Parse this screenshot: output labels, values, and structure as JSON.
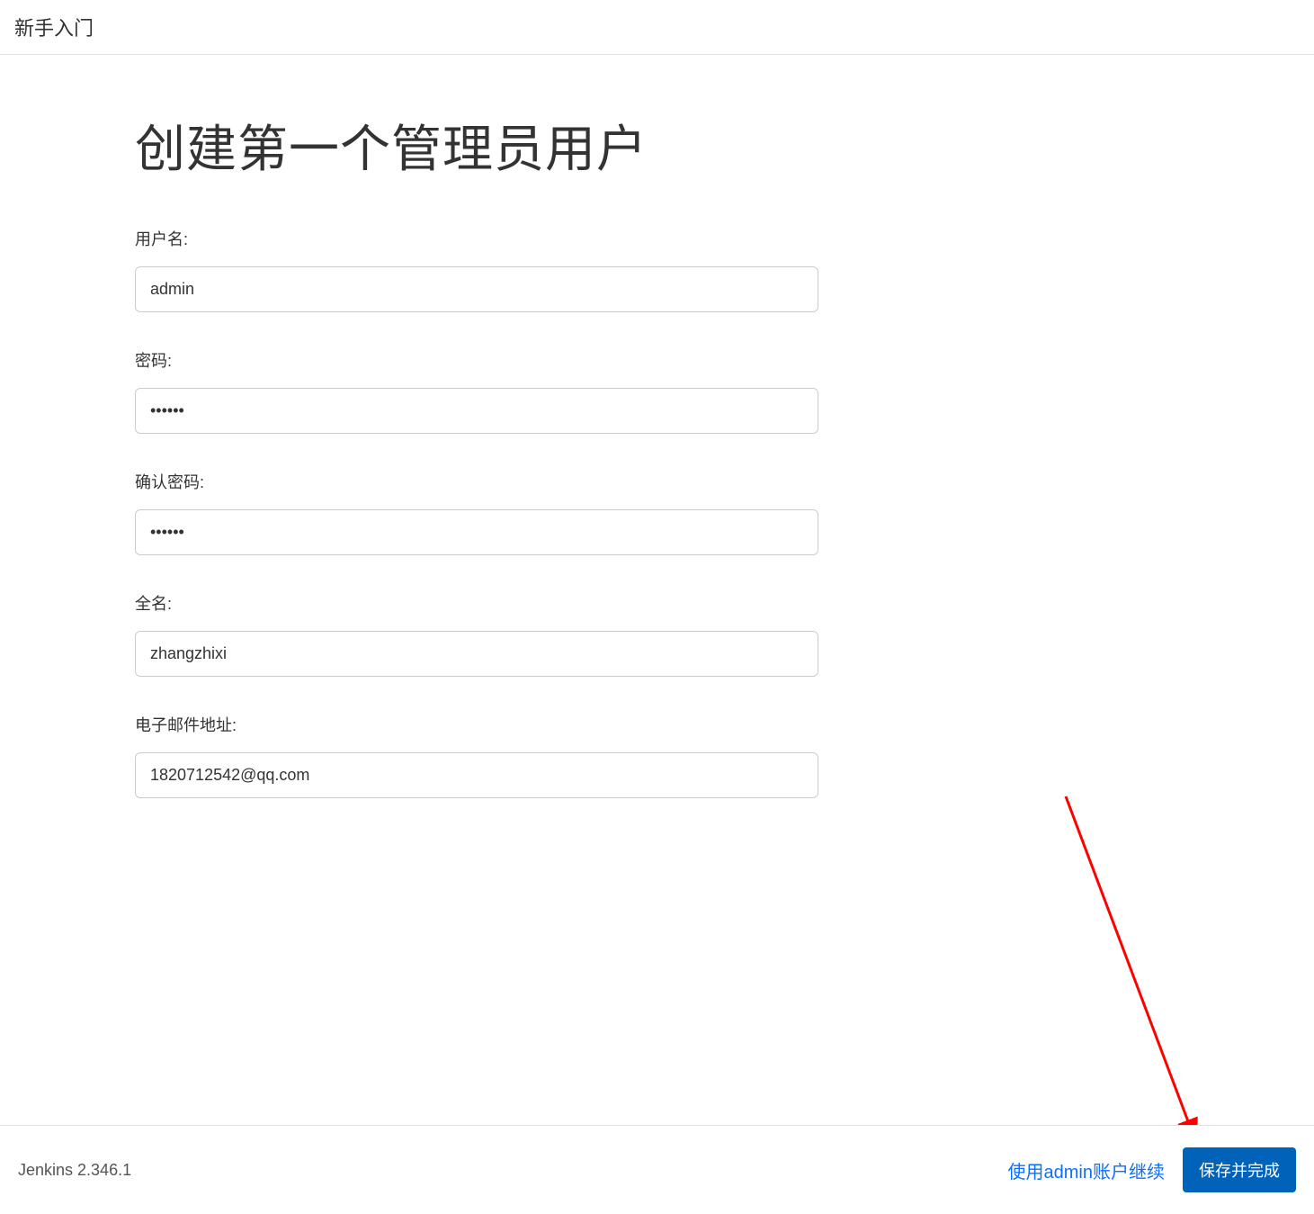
{
  "header": {
    "title": "新手入门"
  },
  "main": {
    "heading": "创建第一个管理员用户",
    "fields": {
      "username": {
        "label": "用户名:",
        "value": "admin"
      },
      "password": {
        "label": "密码:",
        "value": "••••••"
      },
      "confirm_password": {
        "label": "确认密码:",
        "value": "••••••"
      },
      "fullname": {
        "label": "全名:",
        "value": "zhangzhixi"
      },
      "email": {
        "label": "电子邮件地址:",
        "value": "1820712542@qq.com"
      }
    }
  },
  "footer": {
    "version": "Jenkins 2.346.1",
    "skip_label": "使用admin账户继续",
    "save_label": "保存并完成"
  }
}
